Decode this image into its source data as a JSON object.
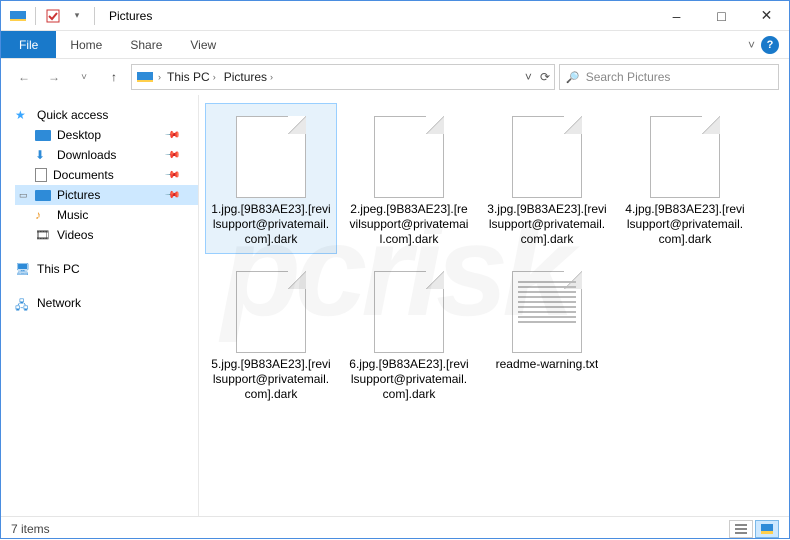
{
  "window": {
    "title": "Pictures",
    "minimize": "–",
    "maximize": "□",
    "close": "✕"
  },
  "ribbon": {
    "file": "File",
    "tabs": [
      "Home",
      "Share",
      "View"
    ],
    "expand": "˅",
    "help": "?"
  },
  "nav_arrows": {
    "back": "←",
    "forward": "→",
    "recent": "˅",
    "up": "↑"
  },
  "address": {
    "root_sep": "›",
    "crumbs": [
      {
        "label": "This PC"
      },
      {
        "label": "Pictures"
      }
    ],
    "dropdown": "˅",
    "refresh": "⟳"
  },
  "search": {
    "placeholder": "Search Pictures",
    "icon": "🔍"
  },
  "sidebar": {
    "quick_access": {
      "label": "Quick access",
      "items": [
        {
          "label": "Desktop",
          "pinned": true
        },
        {
          "label": "Downloads",
          "pinned": true
        },
        {
          "label": "Documents",
          "pinned": true
        },
        {
          "label": "Pictures",
          "pinned": true,
          "selected": true
        },
        {
          "label": "Music",
          "pinned": false
        },
        {
          "label": "Videos",
          "pinned": false
        }
      ]
    },
    "this_pc": {
      "label": "This PC"
    },
    "network": {
      "label": "Network"
    }
  },
  "files": [
    {
      "name": "1.jpg.[9B83AE23].[revilsupport@privatemail.com].dark",
      "kind": "blank",
      "selected": true
    },
    {
      "name": "2.jpeg.[9B83AE23].[revilsupport@privatemail.com].dark",
      "kind": "blank"
    },
    {
      "name": "3.jpg.[9B83AE23].[revilsupport@privatemail.com].dark",
      "kind": "blank"
    },
    {
      "name": "4.jpg.[9B83AE23].[revilsupport@privatemail.com].dark",
      "kind": "blank"
    },
    {
      "name": "5.jpg.[9B83AE23].[revilsupport@privatemail.com].dark",
      "kind": "blank"
    },
    {
      "name": "6.jpg.[9B83AE23].[revilsupport@privatemail.com].dark",
      "kind": "blank"
    },
    {
      "name": "readme-warning.txt",
      "kind": "text"
    }
  ],
  "status": {
    "count_label": "7 items"
  }
}
